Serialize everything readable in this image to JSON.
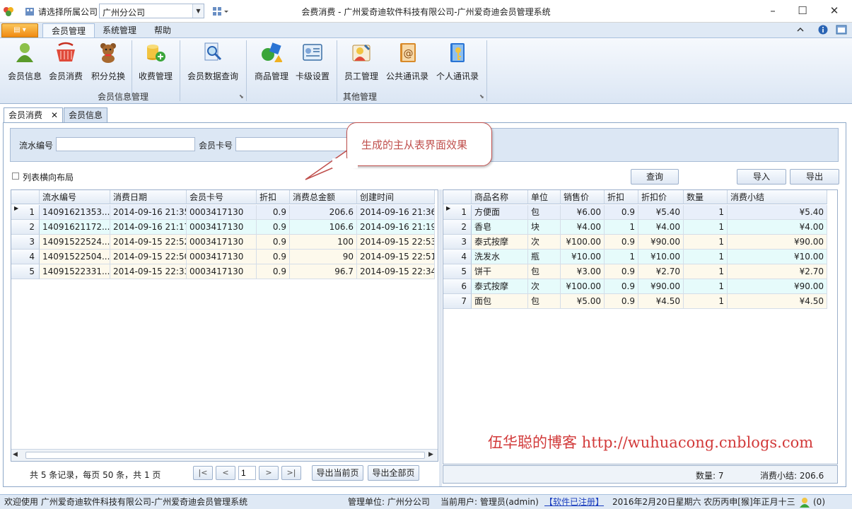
{
  "titlebar": {
    "company_label": "请选择所属公司",
    "company_value": "广州分公司",
    "title": "会费消费 - 广州爱奇迪软件科技有限公司-广州爱奇迪会员管理系统",
    "minimize": "–",
    "maximize": "☐",
    "close": "✕"
  },
  "ribbon": {
    "app_menu": "▤ ▾",
    "tabs": [
      "会员管理",
      "系统管理",
      "帮助"
    ],
    "buttons": [
      "会员信息",
      "会员消费",
      "积分兑换",
      "收费管理",
      "会员数据查询",
      "商品管理",
      "卡级设置",
      "员工管理",
      "公共通讯录",
      "个人通讯录"
    ],
    "groups": [
      "会员信息管理",
      "其他管理"
    ]
  },
  "doc_tabs": [
    "会员消费",
    "会员信息"
  ],
  "search": {
    "serial_label": "流水编号",
    "card_label": "会员卡号",
    "serial_value": "",
    "card_value": ""
  },
  "options": {
    "horizontal_layout_label": "列表横向布局"
  },
  "actions": {
    "query": "查询",
    "import": "导入",
    "export": "导出"
  },
  "master": {
    "columns": [
      "流水编号",
      "消费日期",
      "会员卡号",
      "折扣",
      "消费总金额",
      "创建时间"
    ],
    "rows": [
      [
        "1",
        "14091621353...",
        "2014-09-16 21:35",
        "0003417130",
        "0.9",
        "206.6",
        "2014-09-16 21:36"
      ],
      [
        "2",
        "14091621172...",
        "2014-09-16 21:17",
        "0003417130",
        "0.9",
        "106.6",
        "2014-09-16 21:19"
      ],
      [
        "3",
        "14091522524...",
        "2014-09-15 22:52",
        "0003417130",
        "0.9",
        "100",
        "2014-09-15 22:53"
      ],
      [
        "4",
        "14091522504...",
        "2014-09-15 22:50",
        "0003417130",
        "0.9",
        "90",
        "2014-09-15 22:51"
      ],
      [
        "5",
        "14091522331...",
        "2014-09-15 22:33",
        "0003417130",
        "0.9",
        "96.7",
        "2014-09-15 22:34"
      ]
    ]
  },
  "detail": {
    "columns": [
      "商品名称",
      "单位",
      "销售价",
      "折扣",
      "折扣价",
      "数量",
      "消费小结"
    ],
    "rows": [
      [
        "1",
        "方便面",
        "包",
        "¥6.00",
        "0.9",
        "¥5.40",
        "1",
        "¥5.40"
      ],
      [
        "2",
        "香皂",
        "块",
        "¥4.00",
        "1",
        "¥4.00",
        "1",
        "¥4.00"
      ],
      [
        "3",
        "泰式按摩",
        "次",
        "¥100.00",
        "0.9",
        "¥90.00",
        "1",
        "¥90.00"
      ],
      [
        "4",
        "洗发水",
        "瓶",
        "¥10.00",
        "1",
        "¥10.00",
        "1",
        "¥10.00"
      ],
      [
        "5",
        "饼干",
        "包",
        "¥3.00",
        "0.9",
        "¥2.70",
        "1",
        "¥2.70"
      ],
      [
        "6",
        "泰式按摩",
        "次",
        "¥100.00",
        "0.9",
        "¥90.00",
        "1",
        "¥90.00"
      ],
      [
        "7",
        "面包",
        "包",
        "¥5.00",
        "0.9",
        "¥4.50",
        "1",
        "¥4.50"
      ]
    ],
    "count_summary": "数量: 7",
    "total_summary": "消费小结: 206.6"
  },
  "pager": {
    "info": "共 5 条记录，每页 50 条，共 1 页",
    "first": "|<",
    "prev": "<",
    "page": "1",
    "next": ">",
    "last": ">|",
    "export_current": "导出当前页",
    "export_all": "导出全部页"
  },
  "callout": "生成的主从表界面效果",
  "watermark": "伍华聪的博客 http://wuhuacong.cnblogs.com",
  "statusbar": {
    "welcome": "欢迎使用 广州爱奇迪软件科技有限公司-广州爱奇迪会员管理系统",
    "unit": "管理单位: 广州分公司",
    "user": "当前用户: 管理员(admin)",
    "registered": "【软件已注册】",
    "date": "2016年2月20日星期六 农历丙申[猴]年正月十三",
    "notifications": "(0)"
  },
  "colors": {
    "accent": "#3a6ea5",
    "selected_row": "#e8effa",
    "alt_row_cyan": "#e6fbfb",
    "alt_row_cream": "#fdf9ec",
    "callout": "#c0504d",
    "link": "#1c3fbf"
  }
}
